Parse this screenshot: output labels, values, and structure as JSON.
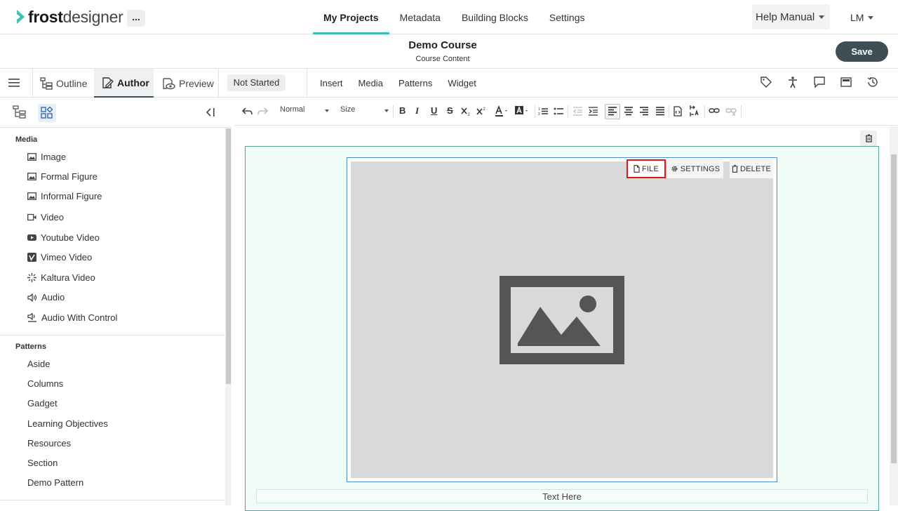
{
  "app": {
    "logo_bold": "frost",
    "logo_light": "designer",
    "more_label": "..."
  },
  "topnav": {
    "tabs": [
      {
        "label": "My Projects",
        "active": true
      },
      {
        "label": "Metadata",
        "active": false
      },
      {
        "label": "Building Blocks",
        "active": false
      },
      {
        "label": "Settings",
        "active": false
      }
    ],
    "help_label": "Help Manual",
    "user_initials": "LM"
  },
  "course": {
    "title": "Demo Course",
    "subtitle": "Course Content",
    "save_label": "Save"
  },
  "modebar": {
    "modes": [
      {
        "label": "Outline",
        "active": false
      },
      {
        "label": "Author",
        "active": true
      },
      {
        "label": "Preview",
        "active": false
      }
    ],
    "status": "Not Started",
    "insert_tabs": [
      "Insert",
      "Media",
      "Patterns",
      "Widget"
    ],
    "right_icons": [
      "tag-icon",
      "accessibility-icon",
      "comment-icon",
      "panel-icon",
      "history-icon"
    ]
  },
  "left_panel": {
    "groups": [
      {
        "title": "Media",
        "items": [
          {
            "label": "Image",
            "icon": "image-icon"
          },
          {
            "label": "Formal Figure",
            "icon": "image-icon"
          },
          {
            "label": "Informal Figure",
            "icon": "image-icon"
          },
          {
            "label": "Video",
            "icon": "video-icon"
          },
          {
            "label": "Youtube Video",
            "icon": "youtube-icon"
          },
          {
            "label": "Vimeo Video",
            "icon": "vimeo-icon"
          },
          {
            "label": "Kaltura Video",
            "icon": "kaltura-icon"
          },
          {
            "label": "Audio",
            "icon": "audio-icon"
          },
          {
            "label": "Audio With Control",
            "icon": "audio-control-icon"
          }
        ]
      },
      {
        "title": "Patterns",
        "items": [
          {
            "label": "Aside"
          },
          {
            "label": "Columns"
          },
          {
            "label": "Gadget"
          },
          {
            "label": "Learning Objectives"
          },
          {
            "label": "Resources"
          },
          {
            "label": "Section"
          },
          {
            "label": "Demo Pattern"
          }
        ]
      }
    ]
  },
  "editor_toolbar": {
    "format_select": "Normal",
    "size_select": "Size",
    "bold": "B",
    "italic": "I",
    "underline": "U",
    "strike": "S"
  },
  "figure": {
    "actions": {
      "file": "FILE",
      "settings": "SETTINGS",
      "delete": "DELETE"
    },
    "caption": "Text Here"
  },
  "colors": {
    "accent": "#33c3bb",
    "save_bg": "#3d4f55",
    "block_bg": "#effcf7",
    "highlight": "#e0161b"
  }
}
